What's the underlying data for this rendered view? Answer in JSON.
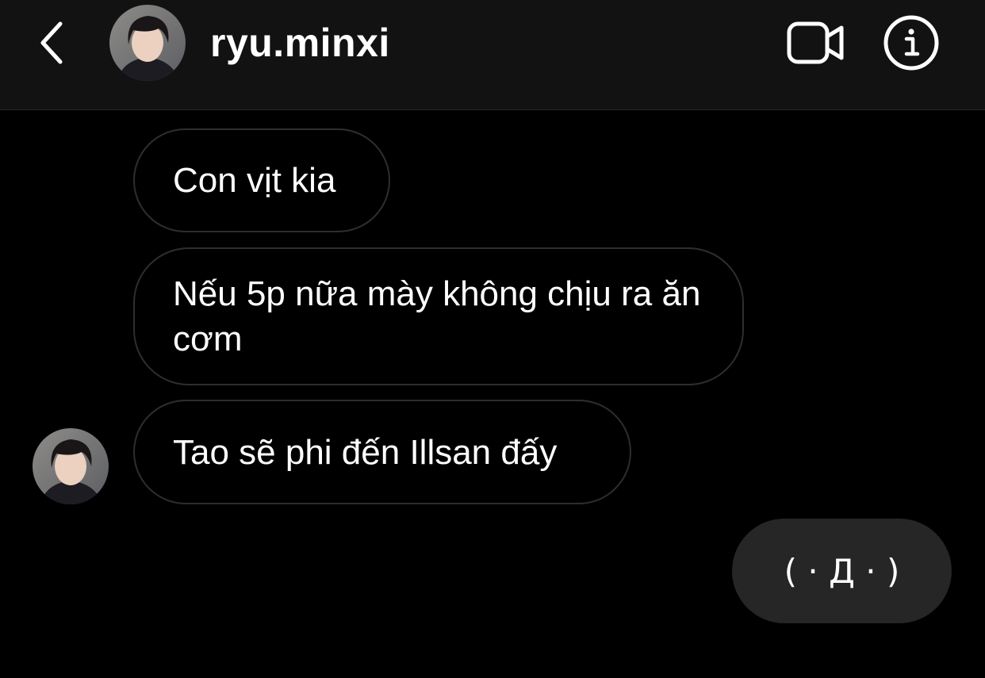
{
  "header": {
    "username": "ryu.minxi",
    "icons": {
      "back": "chevron-left-icon",
      "video": "video-camera-icon",
      "info": "info-icon"
    }
  },
  "messages": [
    {
      "direction": "received",
      "text": "Con vịt kia"
    },
    {
      "direction": "received",
      "text": "Nếu 5p nữa mày không chịu ra ăn cơm"
    },
    {
      "direction": "received",
      "text": "Tao sẽ phi đến Illsan đấy"
    },
    {
      "direction": "sent",
      "text": "( · Д · )"
    }
  ],
  "colors": {
    "background": "#000000",
    "header_background": "#121212",
    "received_bubble_border": "#2e2e2e",
    "sent_bubble": "#262626",
    "text": "#ffffff"
  }
}
